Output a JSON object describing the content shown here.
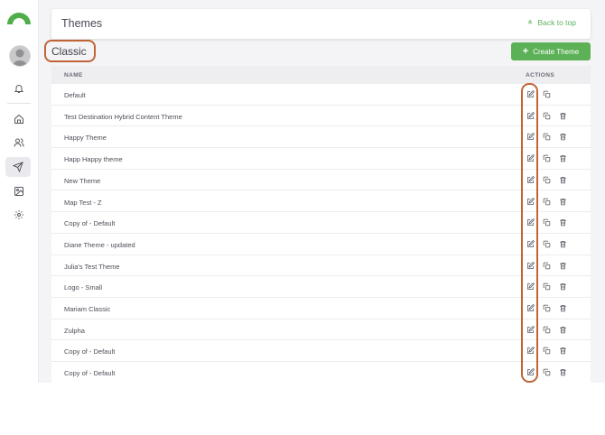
{
  "header": {
    "title": "Themes",
    "back_to_top": "Back to top"
  },
  "section": {
    "title": "Classic",
    "create_button": "Create Theme"
  },
  "table": {
    "columns": {
      "name": "NAME",
      "actions": "ACTIONS"
    },
    "rows": [
      {
        "name": "Default",
        "deletable": false
      },
      {
        "name": "Test Destination Hybrid Content Theme",
        "deletable": true
      },
      {
        "name": "Happy Theme",
        "deletable": true
      },
      {
        "name": "Happ Happy theme",
        "deletable": true
      },
      {
        "name": "New Theme",
        "deletable": true
      },
      {
        "name": "Map Test - Z",
        "deletable": true
      },
      {
        "name": "Copy of - Default",
        "deletable": true
      },
      {
        "name": "Diane Theme - updated",
        "deletable": true
      },
      {
        "name": "Julia's Test Theme",
        "deletable": true
      },
      {
        "name": "Logo - Small",
        "deletable": true
      },
      {
        "name": "Mariam Classic",
        "deletable": true
      },
      {
        "name": "Zulpha",
        "deletable": true
      },
      {
        "name": "Copy of - Default",
        "deletable": true
      },
      {
        "name": "Copy of - Default",
        "deletable": true
      }
    ]
  },
  "sidebar": {
    "icons": [
      "notification-bell-icon",
      "home-icon",
      "users-icon",
      "send-icon",
      "image-icon",
      "settings-icon"
    ],
    "active": "send-icon"
  },
  "colors": {
    "accent": "#5cb156",
    "annotation": "#c06438",
    "text": "#4d4d58"
  }
}
